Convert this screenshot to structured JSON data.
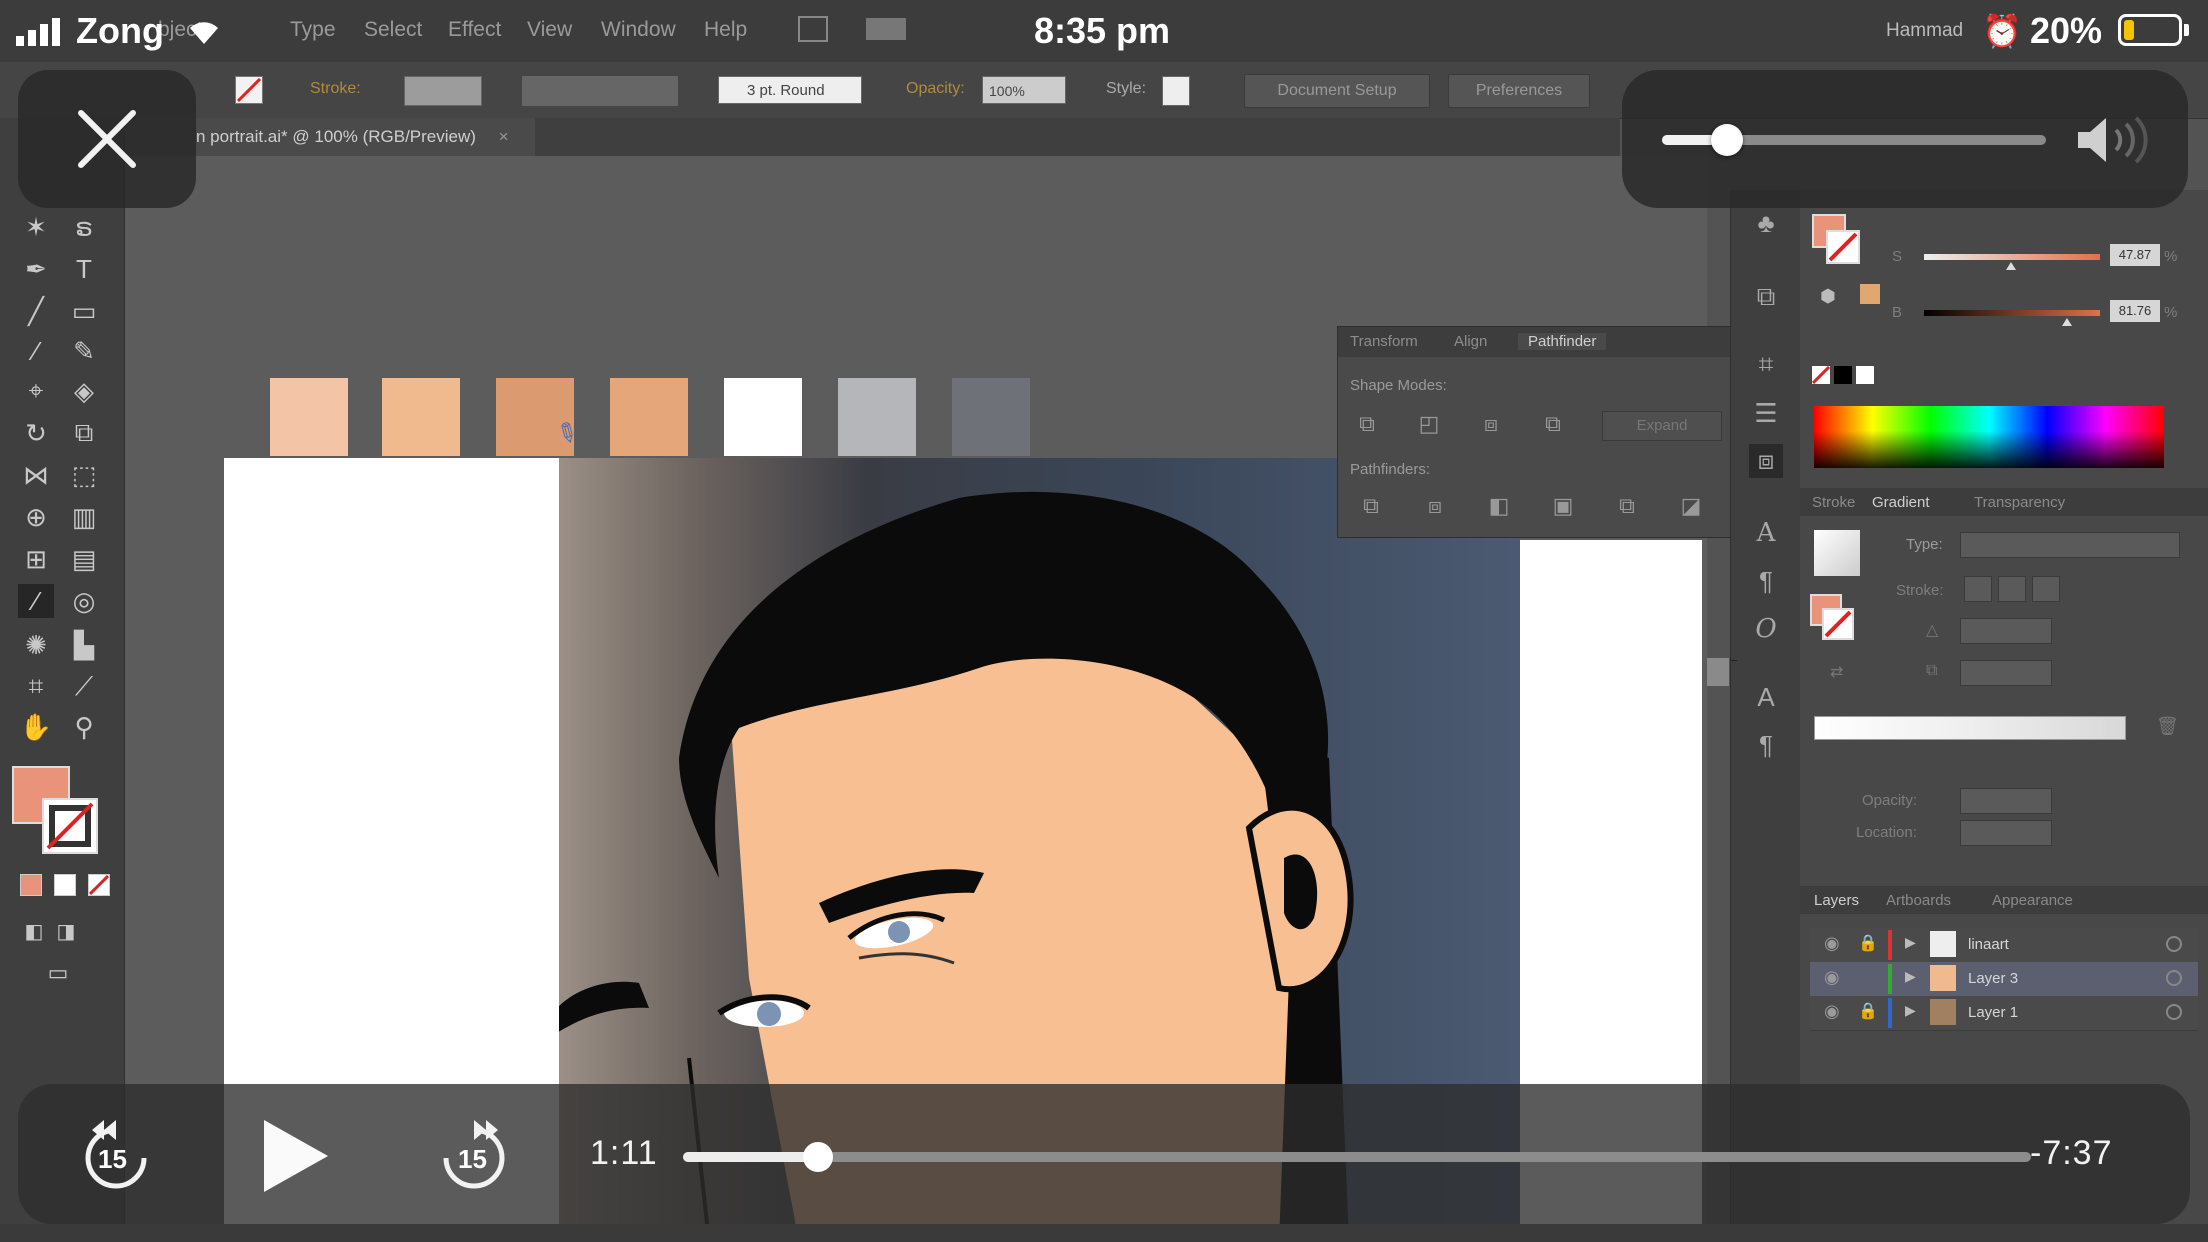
{
  "status_bar": {
    "carrier": "Zong",
    "time": "8:35 pm",
    "user_name": "Hammad",
    "battery_percent": "20%",
    "battery_level": 0.2
  },
  "illustrator": {
    "menu": [
      "bject",
      "Type",
      "Select",
      "Effect",
      "View",
      "Window",
      "Help"
    ],
    "control_bar": {
      "stroke_label": "Stroke:",
      "brush_value": "3 pt. Round",
      "opacity_label": "Opacity:",
      "opacity_value": "100%",
      "style_label": "Style:",
      "document_setup": "Document Setup",
      "preferences": "Preferences"
    },
    "doc_tab": "n portrait.ai* @ 100% (RGB/Preview)",
    "doc_tab_close": "×",
    "swatches": [
      "#f3c4a6",
      "#f0b98e",
      "#dc9a70",
      "#e5a67a",
      "#ffffff",
      "#b4b6b9",
      "#6e7278"
    ],
    "fill_color": "#e8937a",
    "pathfinder": {
      "tabs": [
        "Transform",
        "Align",
        "Pathfinder"
      ],
      "shape_modes_label": "Shape Modes:",
      "expand_label": "Expand",
      "pathfinders_label": "Pathfinders:"
    },
    "color_panel": {
      "s_label": "S",
      "s_value": "47.87",
      "b_label": "B",
      "b_value": "81.76",
      "pct": "%"
    },
    "gradient_panel": {
      "tabs": [
        "Stroke",
        "Gradient",
        "Transparency"
      ],
      "type_label": "Type:",
      "stroke_label": "Stroke:",
      "opacity_label": "Opacity:",
      "location_label": "Location:"
    },
    "layers_panel": {
      "tabs": [
        "Layers",
        "Artboards",
        "Appearance"
      ],
      "layers": [
        {
          "name": "linaart",
          "color": "#d33",
          "selected": false
        },
        {
          "name": "Layer 3",
          "color": "#3a3",
          "selected": true
        },
        {
          "name": "Layer 1",
          "color": "#36c",
          "selected": false
        }
      ]
    }
  },
  "player": {
    "close_icon": "close-icon",
    "volume_level": 0.17,
    "skip_back_label": "15",
    "skip_forward_label": "15",
    "elapsed": "1:11",
    "remaining": "-7:37",
    "progress": 0.1
  }
}
